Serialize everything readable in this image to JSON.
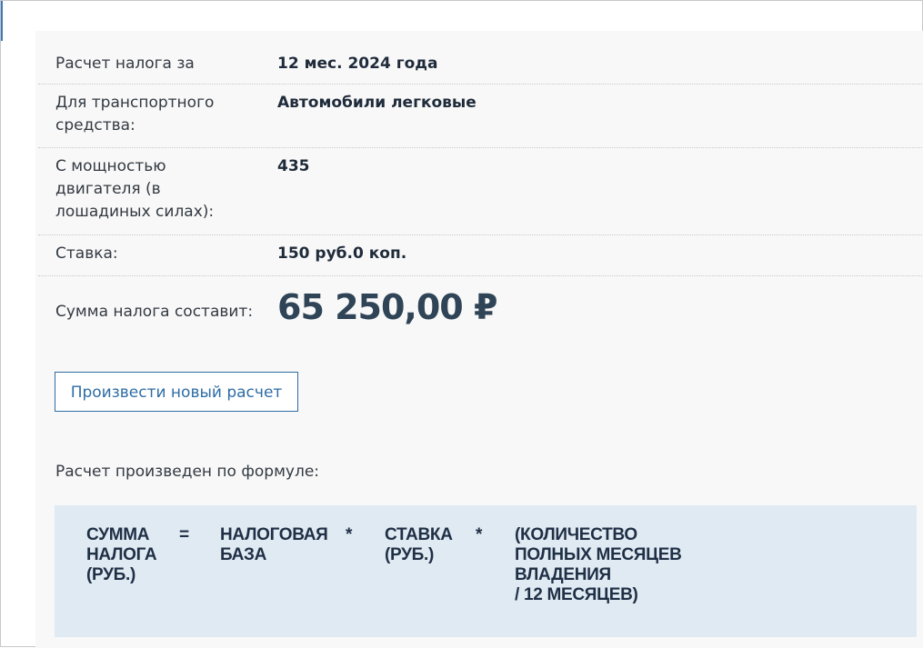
{
  "result": {
    "period_label": "Расчет налога за",
    "period_value": "12 мес. 2024 года",
    "vehicle_label": "Для транспортного средства:",
    "vehicle_value": "Автомобили легковые",
    "power_label": "С мощностью двигателя (в лошадиных силах):",
    "power_value": "435",
    "rate_label": "Ставка:",
    "rate_value": "150 руб.0 коп.",
    "sum_label": "Сумма налога составит:",
    "sum_value": "65 250,00 ₽"
  },
  "actions": {
    "new_calc_label": "Произвести новый расчет"
  },
  "formula": {
    "caption": "Расчет произведен по формуле:",
    "term_sum": "СУММА\nНАЛОГА\n(РУБ.)",
    "op_equals": "=",
    "term_base": "НАЛОГОВАЯ\nБАЗА",
    "op_multiply_1": "*",
    "term_rate": "СТАВКА\n(РУБ.)",
    "op_multiply_2": "*",
    "term_months": "(КОЛИЧЕСТВО\nПОЛНЫХ МЕСЯЦЕВ\nВЛАДЕНИЯ\n/ 12 МЕСЯЦЕВ)"
  }
}
